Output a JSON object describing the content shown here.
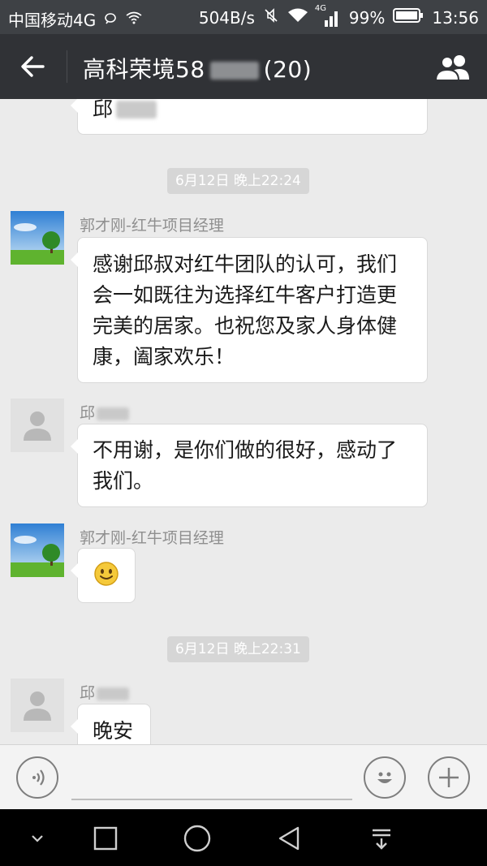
{
  "status_bar": {
    "carrier": "中国移动4G",
    "speed": "504B/s",
    "net_badge": "4G",
    "battery": "99%",
    "time": "13:56"
  },
  "header": {
    "back_icon": "arrow-left-icon",
    "title_prefix": "高科荣境58",
    "title_suffix": "(20)",
    "group_icon": "group-members-icon"
  },
  "messages": {
    "top_fragment": "邱",
    "time_1": "6月12日 晚上22:24",
    "msg_1": {
      "sender": "郭才刚-红牛项目经理",
      "lines": [
        "感谢邱叔对红牛团队的认可，我们",
        "会一如既往为选择红牛客户打造更",
        "完美的居家。也祝您及家人身体健",
        "康，阖家欢乐！"
      ]
    },
    "msg_2": {
      "sender": "邱",
      "lines": [
        "不用谢，是你们做的很好，感动了",
        "我们。"
      ]
    },
    "msg_3": {
      "sender": "郭才刚-红牛项目经理",
      "emoji": "🙂"
    },
    "time_2": "6月12日 晚上22:31",
    "msg_4": {
      "sender": "邱",
      "text": "晚安"
    }
  },
  "input_bar": {
    "voice_icon": "voice-icon",
    "emoji_icon": "emoji-icon",
    "plus_icon": "plus-icon"
  },
  "nav_bar": {
    "icons": [
      "chevron-down-icon",
      "square-icon",
      "circle-icon",
      "triangle-back-icon",
      "notification-pull-icon"
    ]
  }
}
